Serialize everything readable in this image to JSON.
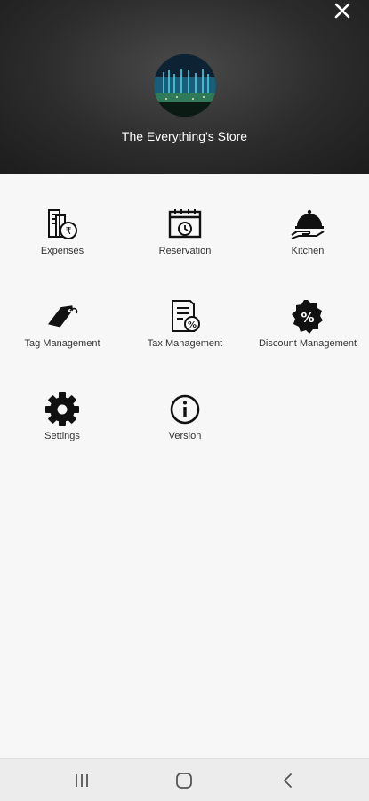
{
  "header": {
    "store_name": "The Everything's Store"
  },
  "menu": {
    "items": [
      {
        "label": "Expenses",
        "icon": "expenses-icon"
      },
      {
        "label": "Reservation",
        "icon": "calendar-clock-icon"
      },
      {
        "label": "Kitchen",
        "icon": "cloche-icon"
      },
      {
        "label": "Tag Management",
        "icon": "tag-icon"
      },
      {
        "label": "Tax Management",
        "icon": "tax-document-icon"
      },
      {
        "label": "Discount Management",
        "icon": "discount-badge-icon"
      },
      {
        "label": "Settings",
        "icon": "gear-icon"
      },
      {
        "label": "Version",
        "icon": "info-icon"
      }
    ]
  },
  "navbar": {
    "buttons": [
      "recent-apps-icon",
      "home-icon",
      "back-icon"
    ]
  }
}
